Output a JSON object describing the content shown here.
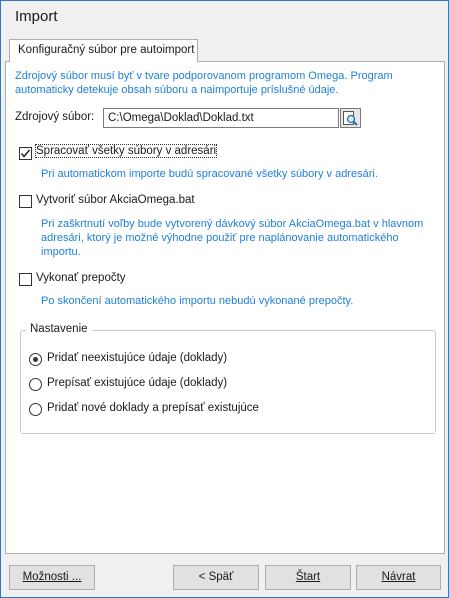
{
  "window": {
    "title": "Import"
  },
  "tab": {
    "label": "Konfiguračný súbor pre autoimport"
  },
  "info_intro": "Zdrojový súbor musí byť v tvare podporovanom programom Omega. Program automaticky detekuje obsah súboru a naimportuje príslušné údaje.",
  "source": {
    "label": "Zdrojový súbor:",
    "value": "C:\\Omega\\Doklad\\Doklad.txt",
    "browse_icon": "browse-file-icon"
  },
  "options": [
    {
      "label": "Spracovať všetky súbory v adresári",
      "checked": true,
      "hint": "Pri automatickom importe budú spracované všetky súbory v adresári."
    },
    {
      "label": "Vytvoriť súbor AkciaOmega.bat",
      "checked": false,
      "hint": "Pri zaškrtnutí voľby bude vytvorený dávkový súbor AkciaOmega.bat v hlavnom adresári, ktorý je možné výhodne použiť pre naplánovanie automatického importu."
    },
    {
      "label": "Vykonať prepočty",
      "checked": false,
      "hint": "Po skončení automatického importu nebudú vykonané prepočty."
    }
  ],
  "settings": {
    "title": "Nastavenie",
    "radios": [
      {
        "label": "Pridať neexistujúce údaje (doklady)",
        "selected": true
      },
      {
        "label": "Prepísať existujúce údaje (doklady)",
        "selected": false
      },
      {
        "label": "Pridať nové doklady a prepísať existujúce",
        "selected": false
      }
    ]
  },
  "buttons": {
    "options": "Možnosti ...",
    "back": "< Späť",
    "start": "Štart",
    "return": "Návrat"
  },
  "colors": {
    "accent": "#1f7fd6",
    "border": "#2f78c8"
  }
}
